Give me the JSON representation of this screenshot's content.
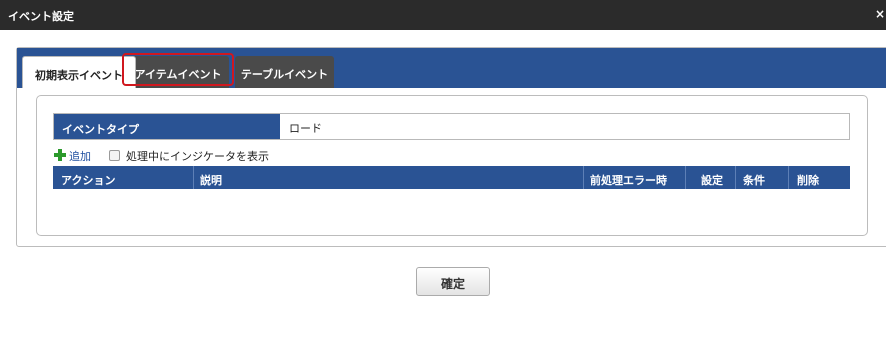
{
  "window": {
    "title": "イベント設定",
    "close_label": "×"
  },
  "tabs": [
    {
      "label": "初期表示イベント",
      "active": true
    },
    {
      "label": "アイテムイベント",
      "active": false,
      "highlighted": true
    },
    {
      "label": "テーブルイベント",
      "active": false
    }
  ],
  "event_type": {
    "label": "イベントタイプ",
    "value": "ロード"
  },
  "toolbar": {
    "add_label": "追加",
    "indicator_label": "処理中にインジケータを表示",
    "indicator_checked": false
  },
  "table": {
    "columns": [
      "アクション",
      "説明",
      "前処理エラー時",
      "設定",
      "条件",
      "削除"
    ],
    "rows": []
  },
  "confirm_label": "確定",
  "colors": {
    "header_blue": "#2a5394",
    "titlebar": "#2b2b2b",
    "highlight_red": "#d0181f",
    "add_green": "#2c9a2c"
  },
  "icons": {
    "add": "plus-icon",
    "close": "close-icon"
  }
}
